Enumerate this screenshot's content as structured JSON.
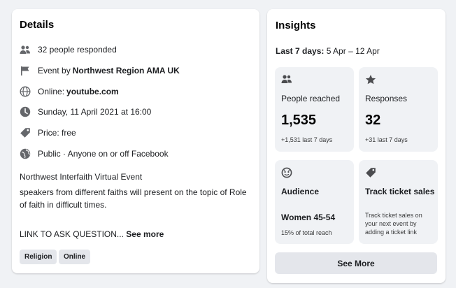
{
  "details": {
    "title": "Details",
    "responded": "32 people responded",
    "event_by_prefix": "Event by ",
    "event_by_name": "Northwest Region AMA UK",
    "online_prefix": "Online: ",
    "online_link": "youtube.com",
    "datetime": "Sunday, 11 April 2021 at 16:00",
    "price": "Price: free",
    "privacy": "Public · Anyone on or off Facebook",
    "event_name": "Northwest Interfaith Virtual Event",
    "description": "speakers from different faiths will present on the topic of Role of faith in difficult times.",
    "link_text": "LINK TO ASK QUESTION... ",
    "see_more": "See more",
    "tags": [
      "Religion",
      "Online"
    ]
  },
  "insights": {
    "title": "Insights",
    "range_label": "Last 7 days:",
    "range_value": " 5 Apr – 12 Apr",
    "people_reached": {
      "label": "People reached",
      "value": "1,535",
      "sub": "+1,531 last 7 days"
    },
    "responses": {
      "label": "Responses",
      "value": "32",
      "sub": "+31 last 7 days"
    },
    "audience": {
      "label": "Audience",
      "value": "Women 45-54",
      "sub": "15% of total reach"
    },
    "track": {
      "label": "Track ticket sales",
      "text": "Track ticket sales on your next event by adding a ticket link"
    },
    "see_more_button": "See More"
  }
}
